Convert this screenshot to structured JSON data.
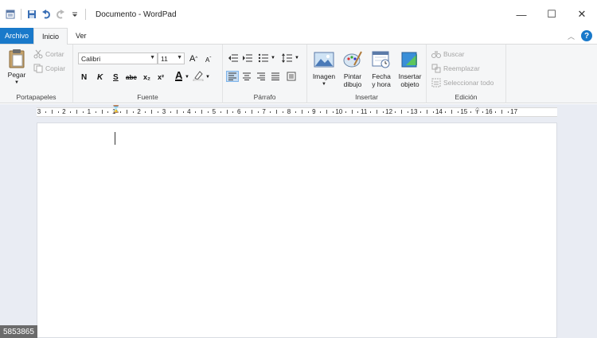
{
  "window": {
    "title": "Documento - WordPad",
    "controls": {
      "minimize": "—",
      "maximize": "☐",
      "close": "✕"
    }
  },
  "tabs": [
    {
      "label": "Archivo",
      "kind": "file"
    },
    {
      "label": "Inicio",
      "kind": "active"
    },
    {
      "label": "Ver",
      "kind": "normal"
    }
  ],
  "help": {
    "label": "?"
  },
  "ribbon": {
    "clipboard": {
      "label": "Portapapeles",
      "paste": "Pegar",
      "cut": "Cortar",
      "copy": "Copiar"
    },
    "font": {
      "label": "Fuente",
      "family": "Calibri",
      "size": "11",
      "grow": "A",
      "shrink": "A",
      "bold": "N",
      "italic": "K",
      "underline": "S",
      "strike": "abc",
      "subscript": "x₂",
      "superscript": "x²",
      "color": "A"
    },
    "paragraph": {
      "label": "Párrafo"
    },
    "insert": {
      "label": "Insertar",
      "image": "Imagen",
      "paint_line1": "Pintar",
      "paint_line2": "dibujo",
      "datetime_line1": "Fecha",
      "datetime_line2": "y hora",
      "object_line1": "Insertar",
      "object_line2": "objeto"
    },
    "editing": {
      "label": "Edición",
      "find": "Buscar",
      "replace": "Reemplazar",
      "select_all": "Seleccionar todo"
    }
  },
  "ruler": {
    "labels": [
      "3",
      "2",
      "1",
      "1",
      "2",
      "3",
      "4",
      "5",
      "6",
      "7",
      "8",
      "9",
      "10",
      "11",
      "12",
      "13",
      "14",
      "15",
      "16",
      "17"
    ]
  },
  "watermark": "5853865",
  "colors": {
    "file_tab": "#1979ca",
    "ribbon_bg": "#f5f6f7",
    "workspace_bg": "#e9ecf3"
  }
}
